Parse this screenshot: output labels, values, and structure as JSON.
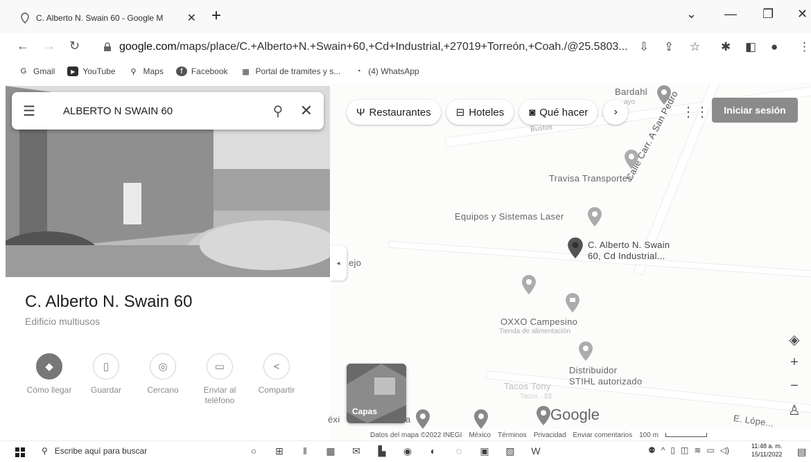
{
  "browser": {
    "tab_title": "C. Alberto N. Swain 60 - Google M",
    "url_domain": "google.com",
    "url_path": "/maps/place/C.+Alberto+N.+Swain+60,+Cd+Industrial,+27019+Torreón,+Coah./@25.5803..."
  },
  "bookmarks": [
    {
      "label": "Gmail",
      "icon": "gmail-icon"
    },
    {
      "label": "YouTube",
      "icon": "youtube-icon"
    },
    {
      "label": "Maps",
      "icon": "maps-icon"
    },
    {
      "label": "Facebook",
      "icon": "facebook-icon"
    },
    {
      "label": "Portal de tramites y s...",
      "icon": "portal-icon"
    },
    {
      "label": "(4) WhatsApp",
      "icon": "whatsapp-icon"
    }
  ],
  "search": {
    "query": "ALBERTO N SWAIN 60"
  },
  "place": {
    "title": "C. Alberto N. Swain 60",
    "type": "Edificio multiusos"
  },
  "actions": [
    {
      "label": "Cómo llegar",
      "icon": "directions-icon"
    },
    {
      "label": "Guardar",
      "icon": "bookmark-icon"
    },
    {
      "label": "Cercano",
      "icon": "nearby-icon"
    },
    {
      "label": "Enviar al teléfono",
      "icon": "send-to-phone-icon"
    },
    {
      "label": "Compartir",
      "icon": "share-icon"
    }
  ],
  "chips": [
    {
      "label": "Restaurantes",
      "icon": "restaurant-icon"
    },
    {
      "label": "Hoteles",
      "icon": "hotel-icon"
    },
    {
      "label": "Qué hacer",
      "icon": "camera-icon"
    }
  ],
  "header": {
    "signin": "Iniciar sesión"
  },
  "map": {
    "labels": {
      "bardahl": "Bardahl",
      "bardahl_sub": "ayo",
      "bustos": "Bustos",
      "calle": "Calle Carr. A San Pedro",
      "travisa": "Travisa Transportes",
      "equipos": "Equipos y Sistemas Laser",
      "selected_1": "C. Alberto N. Swain",
      "selected_2": "60, Cd Industrial...",
      "oxxo": "OXXO Campesino",
      "oxxo_sub": "Tienda de alimentación",
      "stihl_1": "Distribuidor",
      "stihl_2": "STIHL autorizado",
      "tacos": "Tacos Tony",
      "tacos_sub": "Tacos · $$",
      "viejo": "ejo",
      "mexico_frag": "éxi",
      "a_frag": "a",
      "lopez": "E. Lópe..."
    },
    "layers_label": "Capas",
    "google_logo": "Google",
    "footer": {
      "data": "Datos del mapa ©2022 INEGI",
      "country": "México",
      "terms": "Términos",
      "privacy": "Privacidad",
      "feedback": "Enviar comentarios",
      "scale": "100 m"
    }
  },
  "taskbar": {
    "search_placeholder": "Escribe aquí para buscar",
    "time": "11:48 a. m.",
    "date": "15/11/2022"
  }
}
